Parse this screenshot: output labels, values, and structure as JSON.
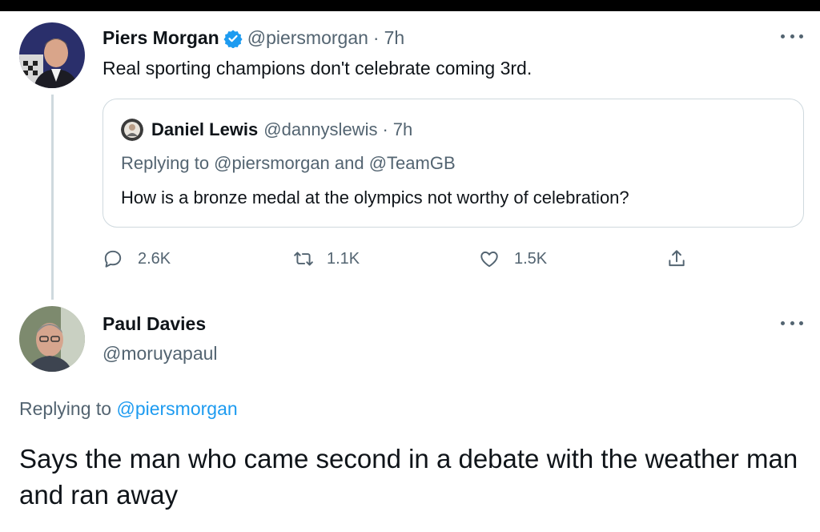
{
  "tweet": {
    "author_name": "Piers Morgan",
    "author_handle": "@piersmorgan",
    "separator": "·",
    "time": "7h",
    "text": "Real sporting champions don't celebrate coming 3rd.",
    "verified": true,
    "quote": {
      "author_name": "Daniel Lewis",
      "author_handle": "@dannyslewis",
      "separator": "·",
      "time": "7h",
      "replying_to": "Replying to @piersmorgan and @TeamGB",
      "text": "How is a bronze medal at the olympics not worthy of celebration?"
    },
    "actions": {
      "replies": "2.6K",
      "retweets": "1.1K",
      "likes": "1.5K"
    }
  },
  "reply": {
    "author_name": "Paul Davies",
    "author_handle": "@moruyapaul",
    "replying_label": "Replying to",
    "replying_handle": "@piersmorgan",
    "text": "Says the man who came second in a debate with the weather man and ran away"
  },
  "colors": {
    "text": "#0f1419",
    "muted": "#536471",
    "link": "#1d9bf0",
    "border": "#cfd9de",
    "verified": "#1d9bf0"
  },
  "icons": [
    "reply-icon",
    "retweet-icon",
    "like-icon",
    "share-icon",
    "verified-badge-icon",
    "more-icon"
  ]
}
